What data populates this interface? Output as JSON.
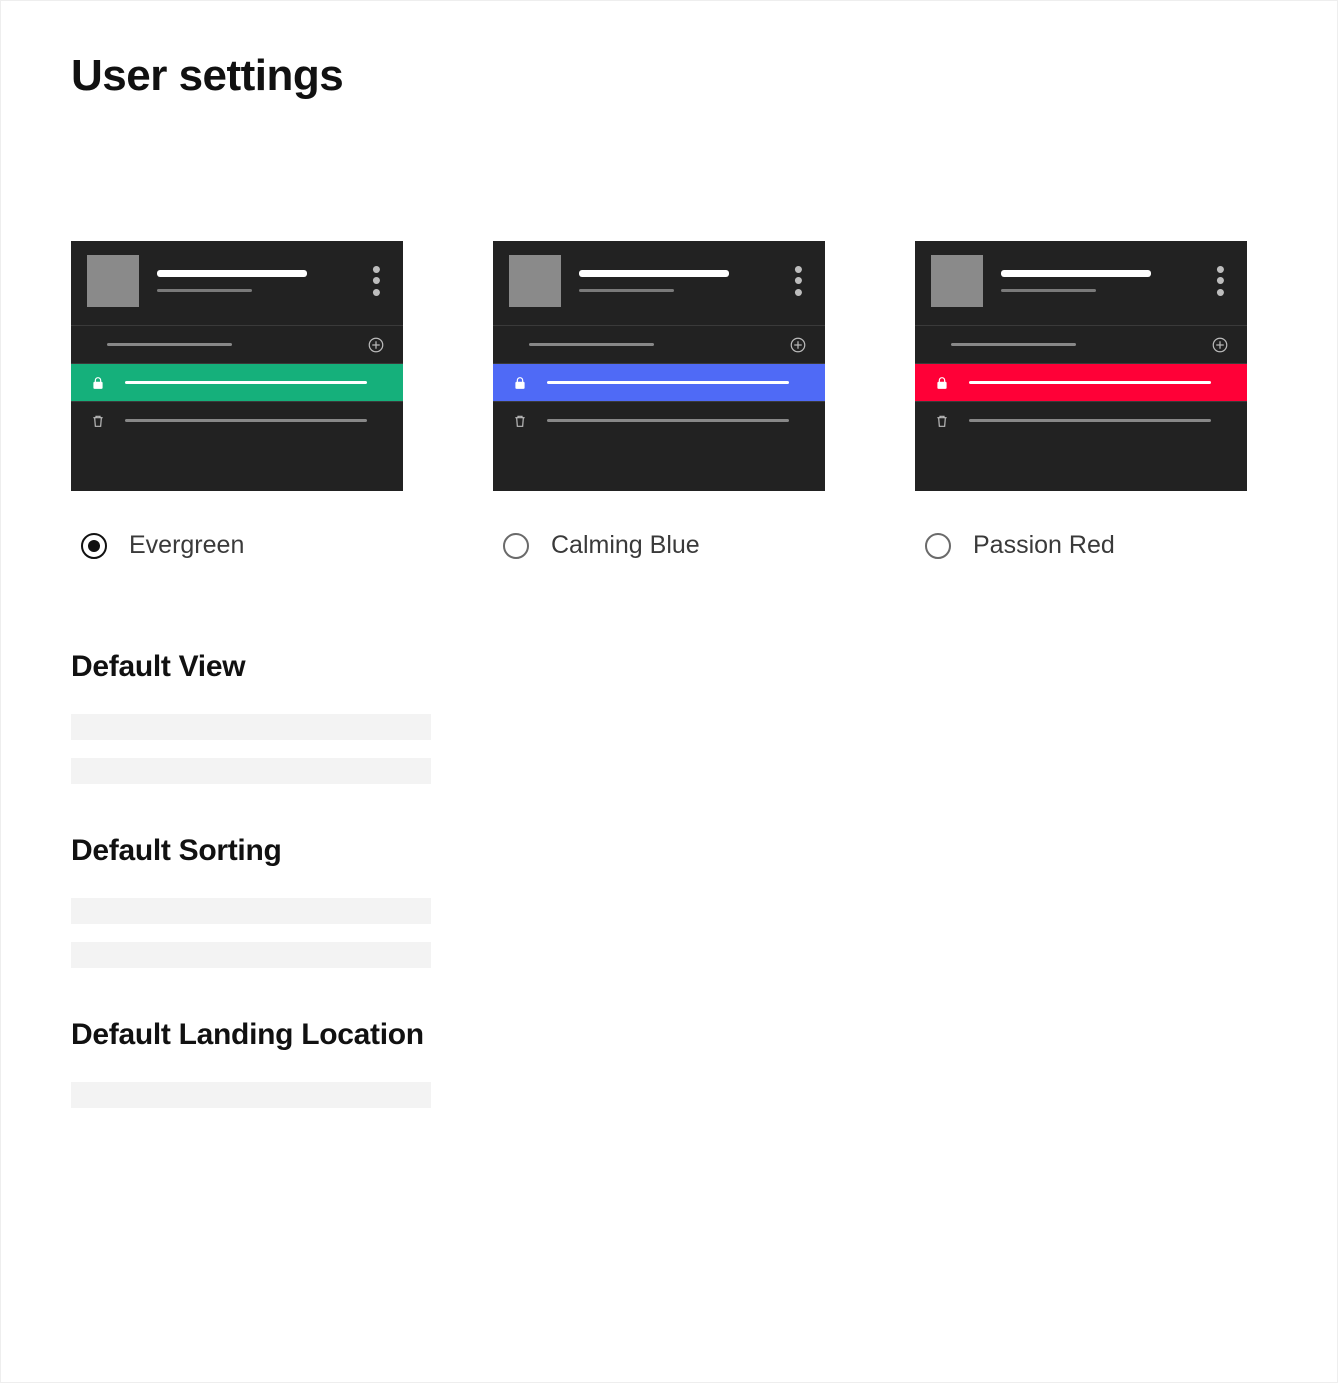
{
  "page": {
    "title": "User settings"
  },
  "themes": {
    "selected": "evergreen",
    "options": [
      {
        "id": "evergreen",
        "label": "Evergreen",
        "accent": "#15b07b"
      },
      {
        "id": "calming-blue",
        "label": "Calming Blue",
        "accent": "#4f6af6"
      },
      {
        "id": "passion-red",
        "label": "Passion Red",
        "accent": "#ff0037"
      }
    ]
  },
  "sections": {
    "default_view": {
      "title": "Default View",
      "placeholders": 2
    },
    "default_sorting": {
      "title": "Default Sorting",
      "placeholders": 2
    },
    "default_landing": {
      "title": "Default Landing Location",
      "placeholders": 1
    }
  }
}
